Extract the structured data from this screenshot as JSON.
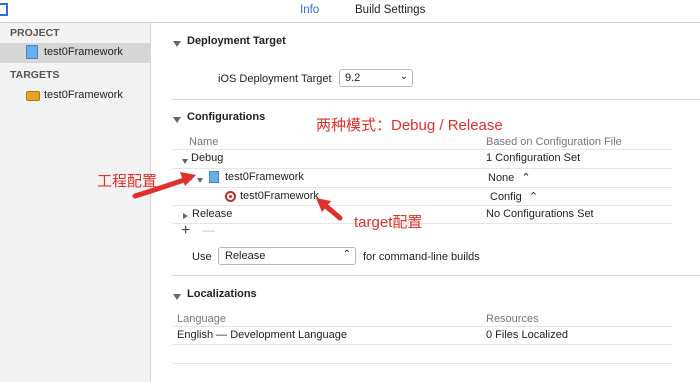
{
  "tabs": {
    "info": "Info",
    "build_settings": "Build Settings"
  },
  "sidebar": {
    "project_header": "PROJECT",
    "project_item": "test0Framework",
    "targets_header": "TARGETS",
    "target_item": "test0Framework"
  },
  "deployment": {
    "title": "Deployment Target",
    "label": "iOS Deployment Target",
    "value": "9.2"
  },
  "configurations": {
    "title": "Configurations",
    "col_name": "Name",
    "col_based": "Based on Configuration File",
    "debug": {
      "name": "Debug",
      "based": "1 Configuration Set"
    },
    "project_row": {
      "name": "test0Framework",
      "based": "None"
    },
    "target_row": {
      "name": "test0Framework",
      "based": "Config"
    },
    "release": {
      "name": "Release",
      "based": "No Configurations Set"
    },
    "add": "+",
    "remove": "—",
    "use_label": "Use",
    "use_value": "Release",
    "use_suffix": "for command-line builds"
  },
  "localizations": {
    "title": "Localizations",
    "col_language": "Language",
    "col_resources": "Resources",
    "row_language": "English — Development Language",
    "row_resources": "0 Files Localized"
  },
  "annotations": {
    "modes": "两种模式：Debug / Release",
    "project_config": "工程配置",
    "target_config": "target配置"
  },
  "colors": {
    "accent": "#2a6fd6",
    "annotation": "#e0302a"
  }
}
